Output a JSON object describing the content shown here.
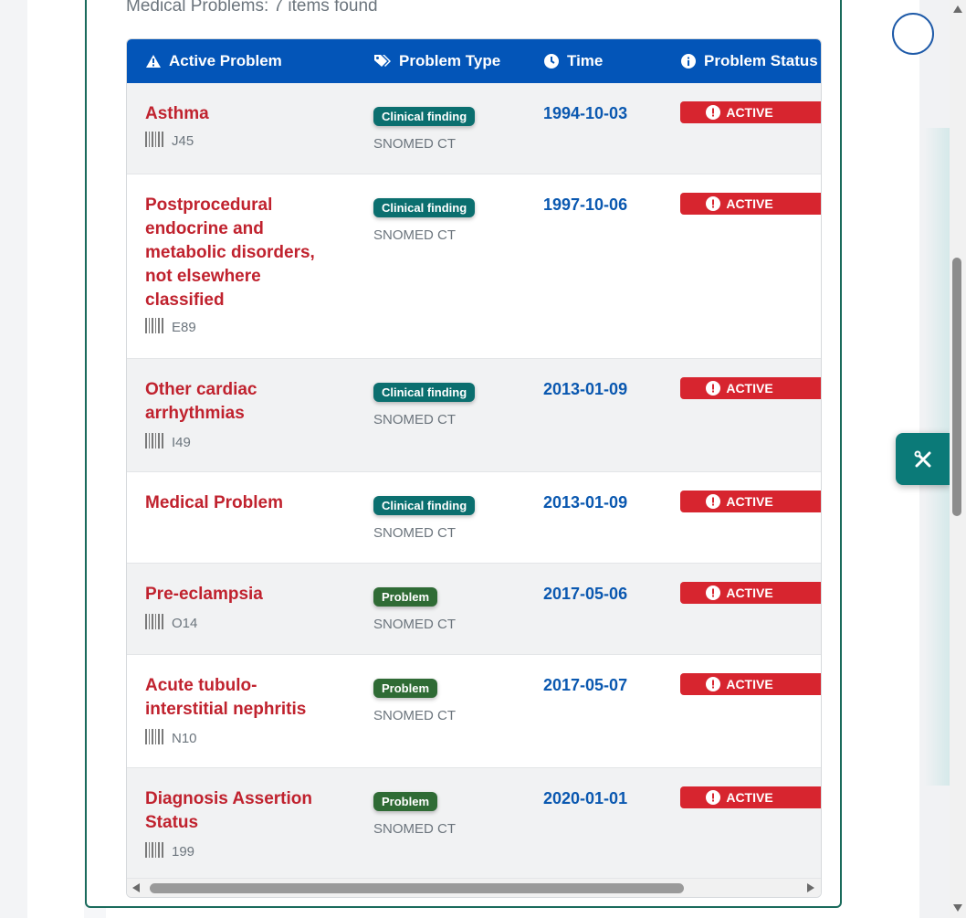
{
  "summary": "Medical Problems: 7 items found",
  "columns": {
    "active_problem": "Active Problem",
    "problem_type": "Problem Type",
    "time": "Time",
    "problem_status": "Problem Status"
  },
  "icons": {
    "active_problem": "warning-triangle-icon",
    "problem_type": "tags-icon",
    "time": "clock-icon",
    "problem_status": "info-circle-icon",
    "code": "barcode-icon",
    "status": "exclamation-circle-icon",
    "tools": "tools-icon"
  },
  "colors": {
    "header_bg": "#0355b8",
    "problem_name": "#c0222e",
    "time": "#0a58b0",
    "status_active": "#d7252f",
    "badge_clinical_finding": "#0b6f6f",
    "badge_problem": "#2f6b35",
    "card_border": "#1a6b5c"
  },
  "rows": [
    {
      "name": "Asthma",
      "code": "J45",
      "type": "Clinical finding",
      "system": "SNOMED CT",
      "time": "1994-10-03",
      "status": "ACTIVE"
    },
    {
      "name": "Postprocedural endocrine and metabolic disorders, not elsewhere classified",
      "code": "E89",
      "type": "Clinical finding",
      "system": "SNOMED CT",
      "time": "1997-10-06",
      "status": "ACTIVE"
    },
    {
      "name": "Other cardiac arrhythmias",
      "code": "I49",
      "type": "Clinical finding",
      "system": "SNOMED CT",
      "time": "2013-01-09",
      "status": "ACTIVE"
    },
    {
      "name": "Medical Problem",
      "code": "",
      "type": "Clinical finding",
      "system": "SNOMED CT",
      "time": "2013-01-09",
      "status": "ACTIVE"
    },
    {
      "name": "Pre-eclampsia",
      "code": "O14",
      "type": "Problem",
      "system": "SNOMED CT",
      "time": "2017-05-06",
      "status": "ACTIVE"
    },
    {
      "name": "Acute tubulo-interstitial nephritis",
      "code": "N10",
      "type": "Problem",
      "system": "SNOMED CT",
      "time": "2017-05-07",
      "status": "ACTIVE"
    },
    {
      "name": "Diagnosis Assertion Status",
      "code": "199",
      "type": "Problem",
      "system": "SNOMED CT",
      "time": "2020-01-01",
      "status": "ACTIVE"
    }
  ]
}
